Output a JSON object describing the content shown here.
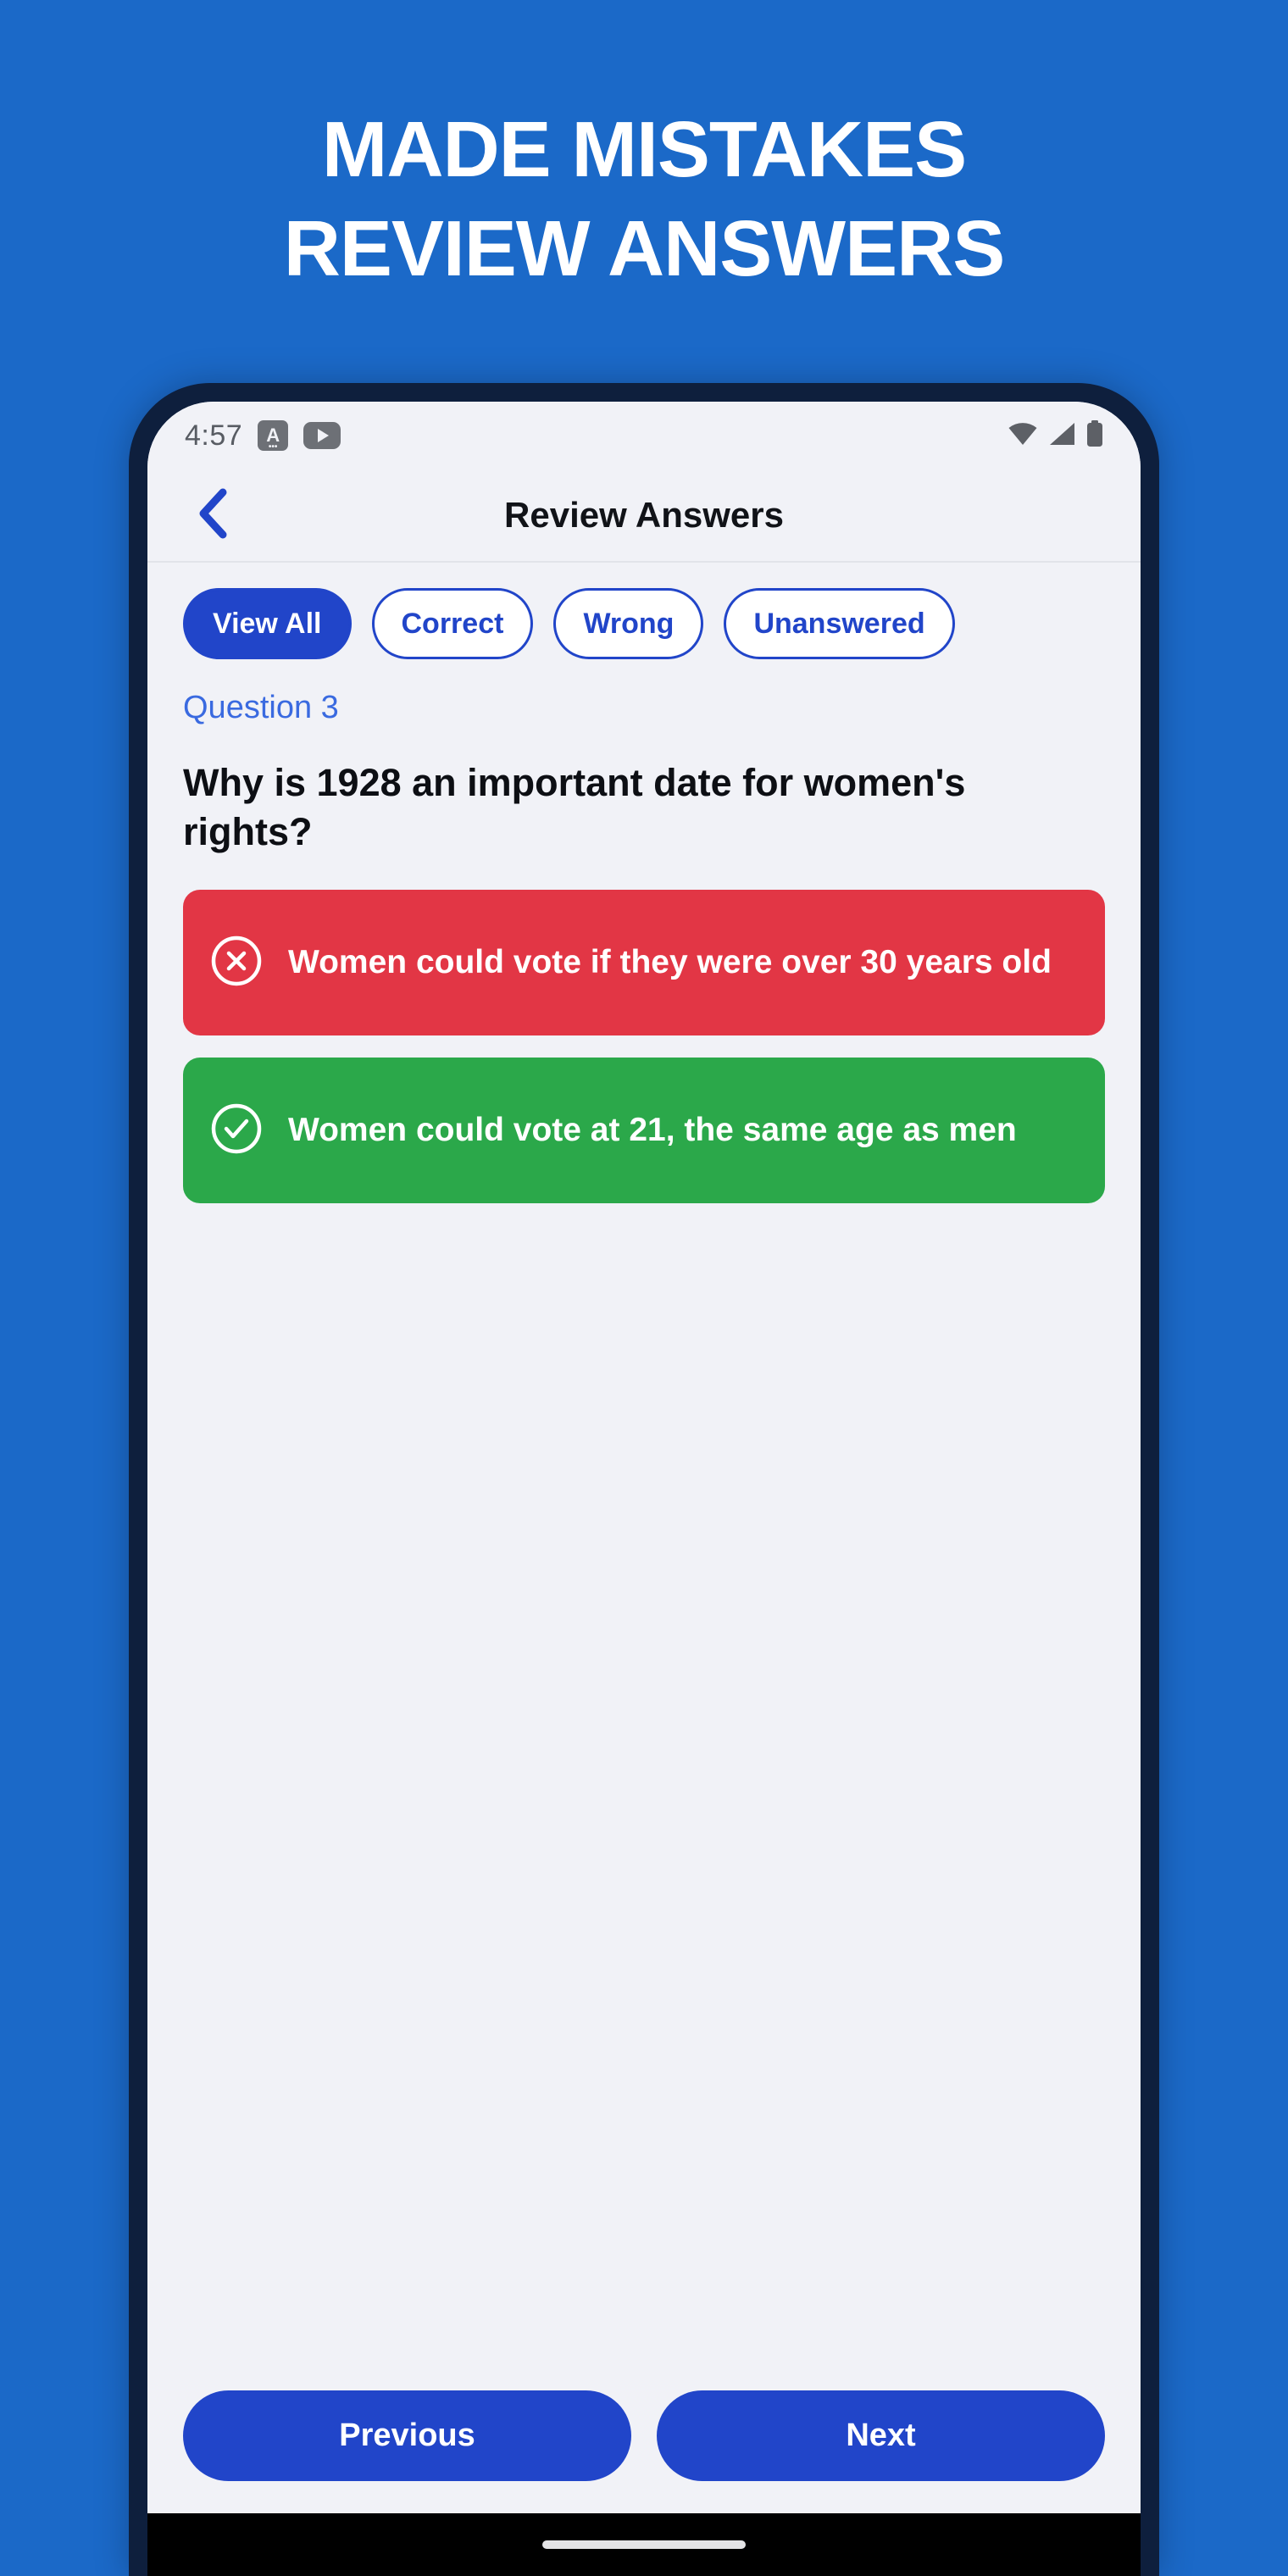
{
  "promo": {
    "headline_lines": [
      "MADE MISTAKES",
      "REVIEW ANSWERS"
    ],
    "background_color": "#1b69c8",
    "text_color": "#ffffff"
  },
  "device": {
    "frame_color": "#0e1f3d",
    "screen_background": "#f1f2f7"
  },
  "status_bar": {
    "clock": "4:57",
    "left_icons": [
      {
        "name": "keyboard-language-icon",
        "glyph": "A"
      },
      {
        "name": "youtube-play-icon",
        "glyph": "▶"
      }
    ],
    "right_icons": [
      {
        "name": "wifi-icon"
      },
      {
        "name": "cellular-signal-icon"
      },
      {
        "name": "battery-icon"
      }
    ]
  },
  "app_bar": {
    "back_label": "‹",
    "title": "Review Answers",
    "title_color": "#111318",
    "back_color": "#2145c9"
  },
  "filters": {
    "items": [
      {
        "label": "View All",
        "active": true
      },
      {
        "label": "Correct",
        "active": false
      },
      {
        "label": "Wrong",
        "active": false
      },
      {
        "label": "Unanswered",
        "active": false
      }
    ],
    "active_background": "#2145c9",
    "inactive_text_color": "#2145c9"
  },
  "question": {
    "label": "Question 3",
    "label_color": "#3a6ae0",
    "text": "Why is 1928 an important date for women's rights?"
  },
  "answers": [
    {
      "status": "wrong",
      "icon": "circle-x-icon",
      "text": "Women could vote if they were over 30 years old",
      "background": "#e23645"
    },
    {
      "status": "correct",
      "icon": "circle-check-icon",
      "text": "Women could vote at 21, the same age as men",
      "background": "#2ba84a"
    }
  ],
  "bottom_nav": {
    "previous_label": "Previous",
    "next_label": "Next",
    "button_color": "#2145c9"
  }
}
